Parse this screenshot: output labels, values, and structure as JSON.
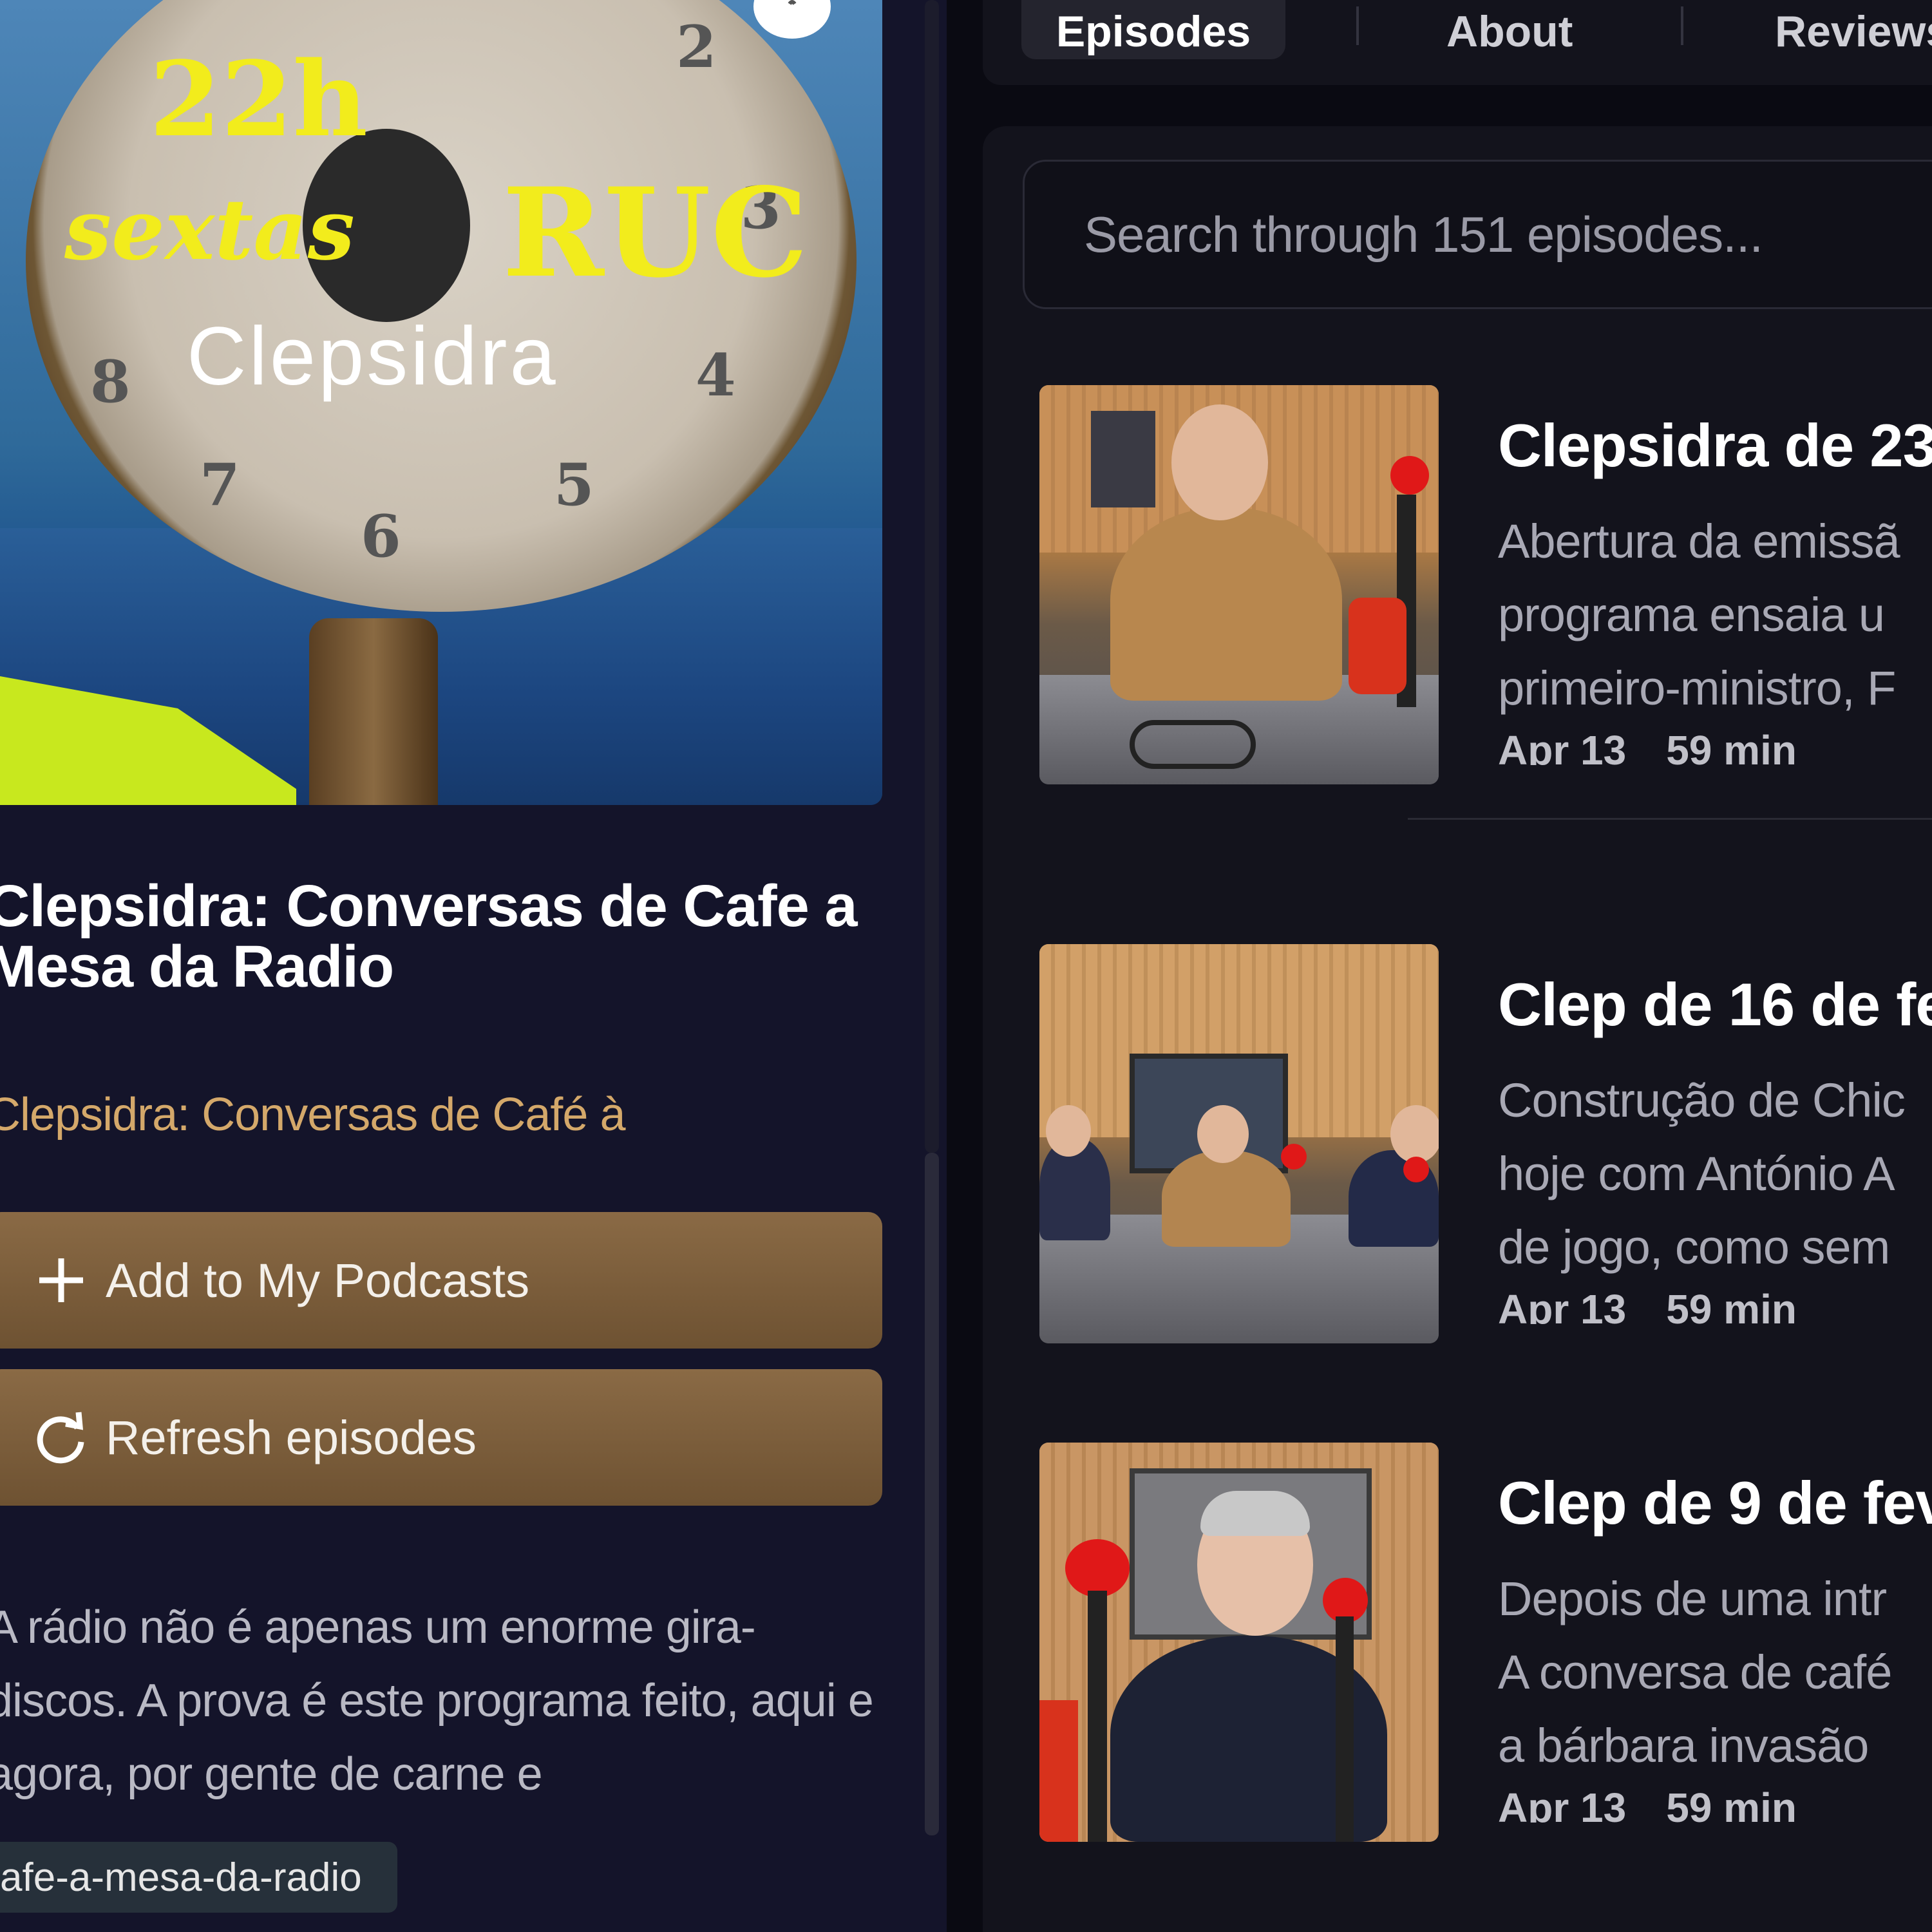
{
  "cover": {
    "time": "22h",
    "day": "sextas",
    "station": "RUC",
    "title": "Clepsidra"
  },
  "podcast": {
    "title": "Clepsidra: Conversas de Cafe a Mesa da Radio",
    "author": "Clepsidra: Conversas de Café à",
    "description": "A rádio não é apenas um enorme gira-discos. A prova é este programa feito, aqui e agora, por gente de carne e",
    "slug": "afe-a-mesa-da-radio"
  },
  "buttons": {
    "add_label": "Add to My Podcasts",
    "refresh_label": "Refresh episodes"
  },
  "tabs": {
    "episodes": "Episodes",
    "about": "About",
    "reviews": "Reviews"
  },
  "search": {
    "placeholder": "Search through 151 episodes..."
  },
  "episodes": [
    {
      "title": "Clepsidra de 23",
      "summary": "Abertura da emissã\nprograma ensaia u\nprimeiro-ministro, F",
      "date": "Apr 13",
      "duration": "59 min"
    },
    {
      "title": "Clep de 16 de fev",
      "summary": "Construção de Chic\nhoje com António A\nde jogo, como sem",
      "date": "Apr 13",
      "duration": "59 min"
    },
    {
      "title": "Clep de 9 de fev",
      "summary": "Depois de uma intr\nA conversa de café\na bárbara invasão",
      "date": "Apr 13",
      "duration": "59 min"
    }
  ],
  "colors": {
    "accent_button": "#7a5c3a",
    "author_text": "#d4a86a",
    "left_bg": "#14142a",
    "right_bg": "#13131c"
  },
  "icons": [
    "plus-icon",
    "refresh-icon",
    "podcast-logo-icon"
  ]
}
